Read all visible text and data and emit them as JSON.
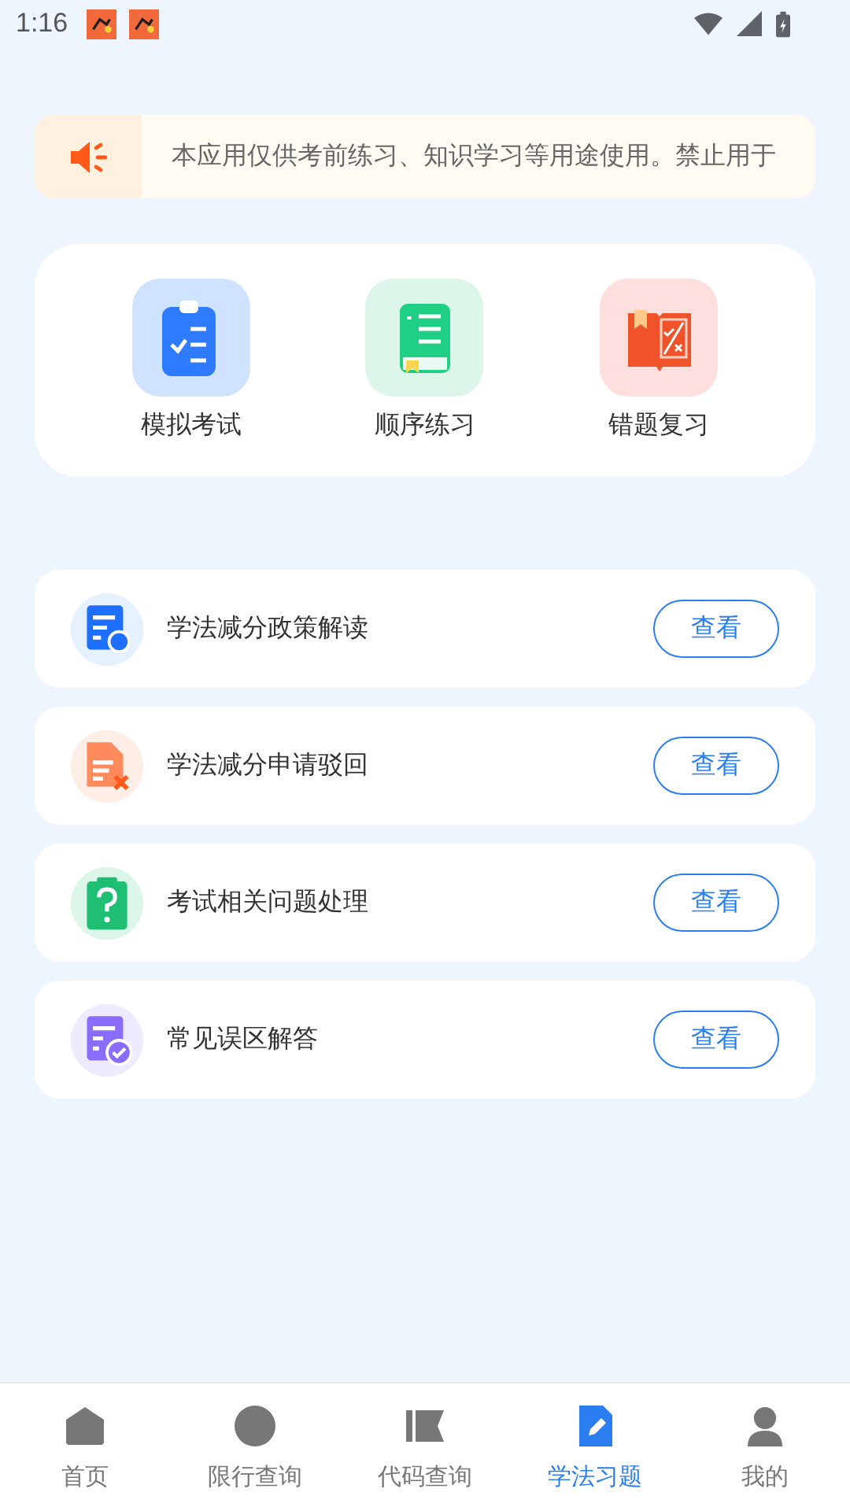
{
  "status_bar": {
    "time": "1:16"
  },
  "notice": {
    "text": "本应用仅供考前练习、知识学习等用途使用。禁止用于"
  },
  "shortcuts": [
    {
      "label": "模拟考试",
      "kind": "exam"
    },
    {
      "label": "顺序练习",
      "kind": "book"
    },
    {
      "label": "错题复习",
      "kind": "review"
    }
  ],
  "topics": [
    {
      "title": "学法减分政策解读",
      "kind": "policy",
      "button": "查看"
    },
    {
      "title": "学法减分申请驳回",
      "kind": "reject",
      "button": "查看"
    },
    {
      "title": "考试相关问题处理",
      "kind": "question",
      "button": "查看"
    },
    {
      "title": "常见误区解答",
      "kind": "faq",
      "button": "查看"
    }
  ],
  "tabs": [
    {
      "label": "首页",
      "kind": "home",
      "selected": false
    },
    {
      "label": "限行查询",
      "kind": "circle",
      "selected": false
    },
    {
      "label": "代码查询",
      "kind": "flag",
      "selected": false
    },
    {
      "label": "学法习题",
      "kind": "edit",
      "selected": true
    },
    {
      "label": "我的",
      "kind": "user",
      "selected": false
    }
  ]
}
